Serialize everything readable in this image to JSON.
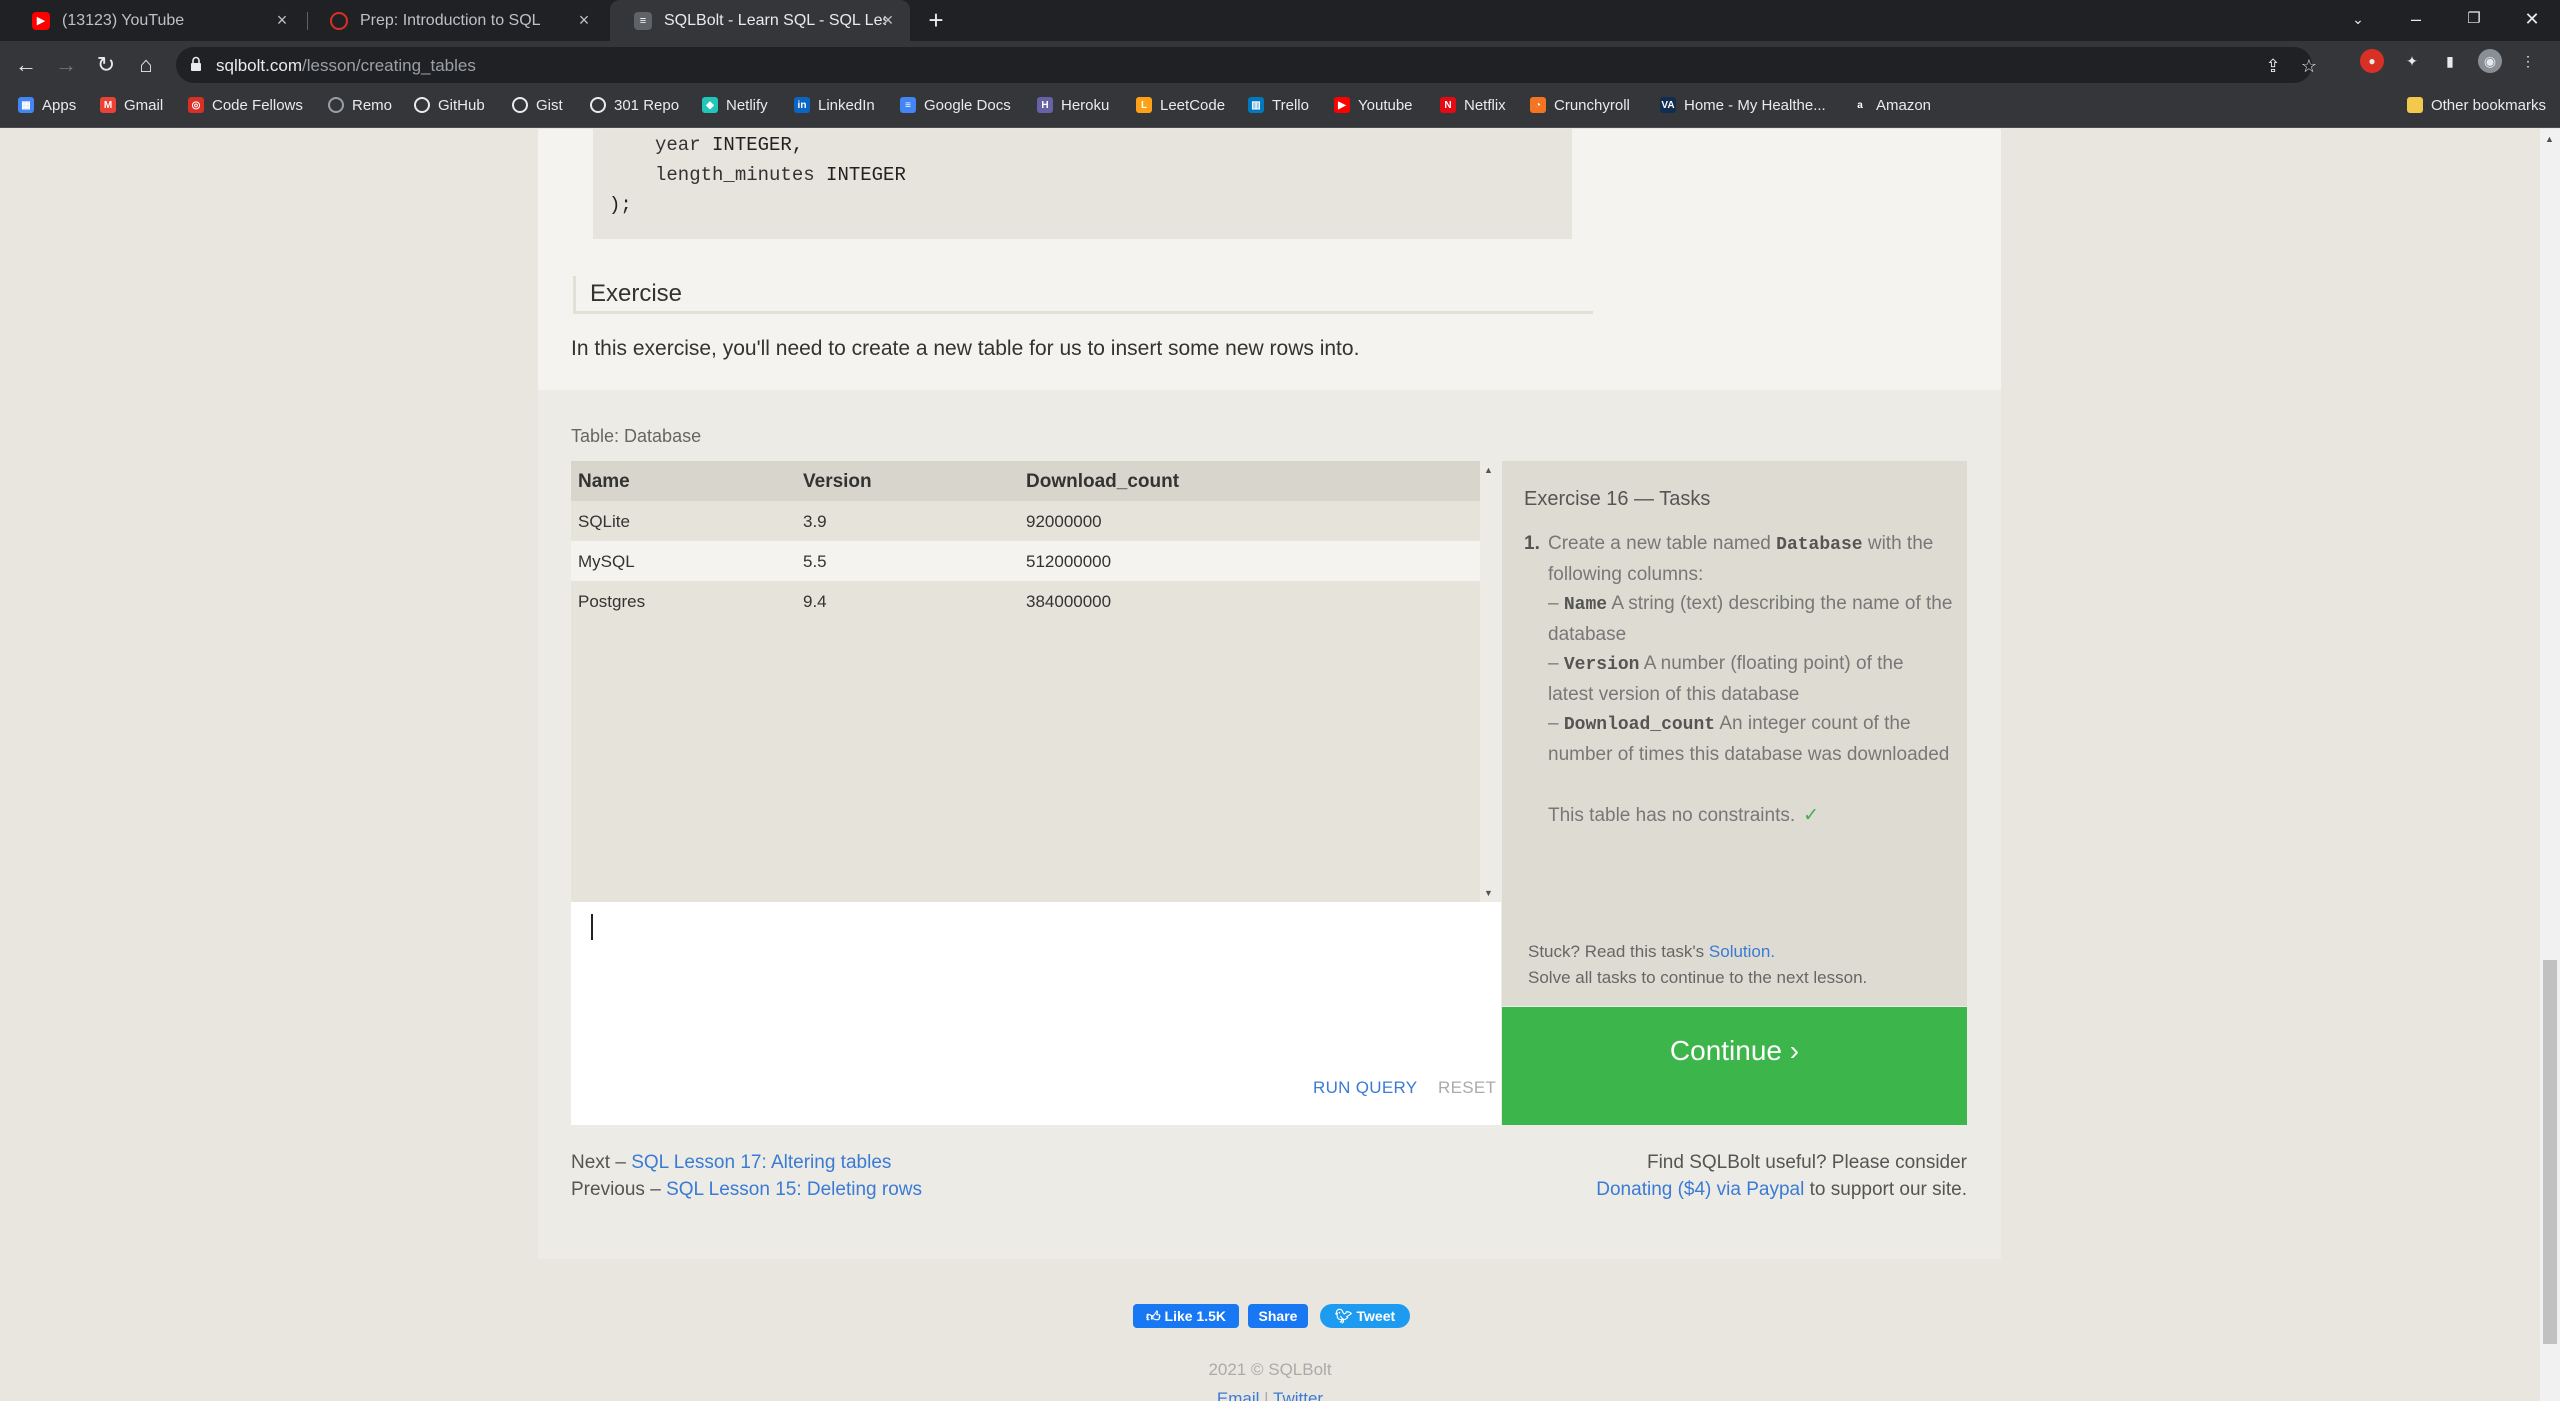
{
  "browser": {
    "tabs": [
      {
        "title": "(13123) YouTube",
        "icon": "youtube-icon",
        "color": "#ff0000",
        "active": false
      },
      {
        "title": "Prep: Introduction to SQL",
        "icon": "codefellows-icon",
        "color": "#d93025",
        "active": false
      },
      {
        "title": "SQLBolt - Learn SQL - SQL Lesso",
        "icon": "sqlbolt-icon",
        "color": "#9aa0a6",
        "active": true
      }
    ],
    "url_host": "sqlbolt.com",
    "url_path": "/lesson/creating_tables",
    "bookmarks": [
      {
        "label": "Apps",
        "icon": "apps-grid-icon",
        "color": "#4285f4"
      },
      {
        "label": "Gmail",
        "icon": "gmail-icon",
        "color": "#ea4335"
      },
      {
        "label": "Code Fellows",
        "icon": "codefellows-icon",
        "color": "#d93025"
      },
      {
        "label": "Remo",
        "icon": "remo-icon",
        "color": "#9aa0a6"
      },
      {
        "label": "GitHub",
        "icon": "github-icon",
        "color": "#e8eaed"
      },
      {
        "label": "Gist",
        "icon": "github-icon",
        "color": "#e8eaed"
      },
      {
        "label": "301 Repo",
        "icon": "github-icon",
        "color": "#e8eaed"
      },
      {
        "label": "Netlify",
        "icon": "netlify-icon",
        "color": "#20c6b7"
      },
      {
        "label": "LinkedIn",
        "icon": "linkedin-icon",
        "color": "#0a66c2"
      },
      {
        "label": "Google Docs",
        "icon": "google-docs-icon",
        "color": "#4285f4"
      },
      {
        "label": "Heroku",
        "icon": "heroku-icon",
        "color": "#6762a6"
      },
      {
        "label": "LeetCode",
        "icon": "leetcode-icon",
        "color": "#ffa116"
      },
      {
        "label": "Trello",
        "icon": "trello-icon",
        "color": "#0079bf"
      },
      {
        "label": "Youtube",
        "icon": "youtube-icon",
        "color": "#ff0000"
      },
      {
        "label": "Netflix",
        "icon": "netflix-icon",
        "color": "#e50914"
      },
      {
        "label": "Crunchyroll",
        "icon": "crunchyroll-icon",
        "color": "#f47521"
      },
      {
        "label": "Home - My Healthe...",
        "icon": "va-icon",
        "color": "#112e51"
      },
      {
        "label": "Amazon",
        "icon": "amazon-icon",
        "color": "#ffffff"
      }
    ],
    "other_bookmarks": "Other bookmarks"
  },
  "lesson": {
    "code_lines": [
      {
        "col": "year",
        "type": "INTEGER,"
      },
      {
        "col": "length_minutes",
        "type": "INTEGER"
      }
    ],
    "code_close": ");",
    "exercise_heading": "Exercise",
    "exercise_intro": "In this exercise, you'll need to create a new table for us to insert some new rows into."
  },
  "table": {
    "caption": "Table: Database",
    "columns": [
      "Name",
      "Version",
      "Download_count"
    ],
    "rows": [
      [
        "SQLite",
        "3.9",
        "92000000"
      ],
      [
        "MySQL",
        "5.5",
        "512000000"
      ],
      [
        "Postgres",
        "9.4",
        "384000000"
      ]
    ]
  },
  "editor": {
    "value": "",
    "run_label": "RUN QUERY",
    "reset_label": "RESET"
  },
  "tasks": {
    "title": "Exercise 16 — Tasks",
    "number": "1.",
    "text_prefix": "Create a new table named",
    "table_name": "Database",
    "text_suffix": "with the following columns:",
    "col1_name": "Name",
    "col1_desc": "A string (text) describing the name of the database",
    "col2_name": "Version",
    "col2_desc": "A number (floating point) of the latest version of this database",
    "col3_name": "Download_count",
    "col3_desc": "An integer count of the number of times this database was downloaded",
    "constraints": "This table has no constraints.",
    "stuck_prefix": "Stuck? Read this task's",
    "solution_link": "Solution.",
    "solve_all": "Solve all tasks to continue to the next lesson.",
    "continue_label": "Continue ›"
  },
  "footer": {
    "next_prefix": "Next –",
    "next_link": "SQL Lesson 17: Altering tables",
    "prev_prefix": "Previous –",
    "prev_link": "SQL Lesson 15: Deleting rows",
    "useful": "Find SQLBolt useful? Please consider",
    "donate_link": "Donating ($4) via Paypal",
    "donate_suffix": "to support our site.",
    "like_label": "Like 1.5K",
    "share_label": "Share",
    "tweet_label": "Tweet",
    "copyright": "2021 © SQLBolt",
    "email_link": "Email",
    "separator": "|",
    "twitter_link": "Twitter"
  },
  "colors": {
    "accent_link": "#3a7bd5",
    "continue_green": "#3cb54a",
    "facebook_blue": "#1877f2",
    "twitter_blue": "#1d9bf0"
  }
}
